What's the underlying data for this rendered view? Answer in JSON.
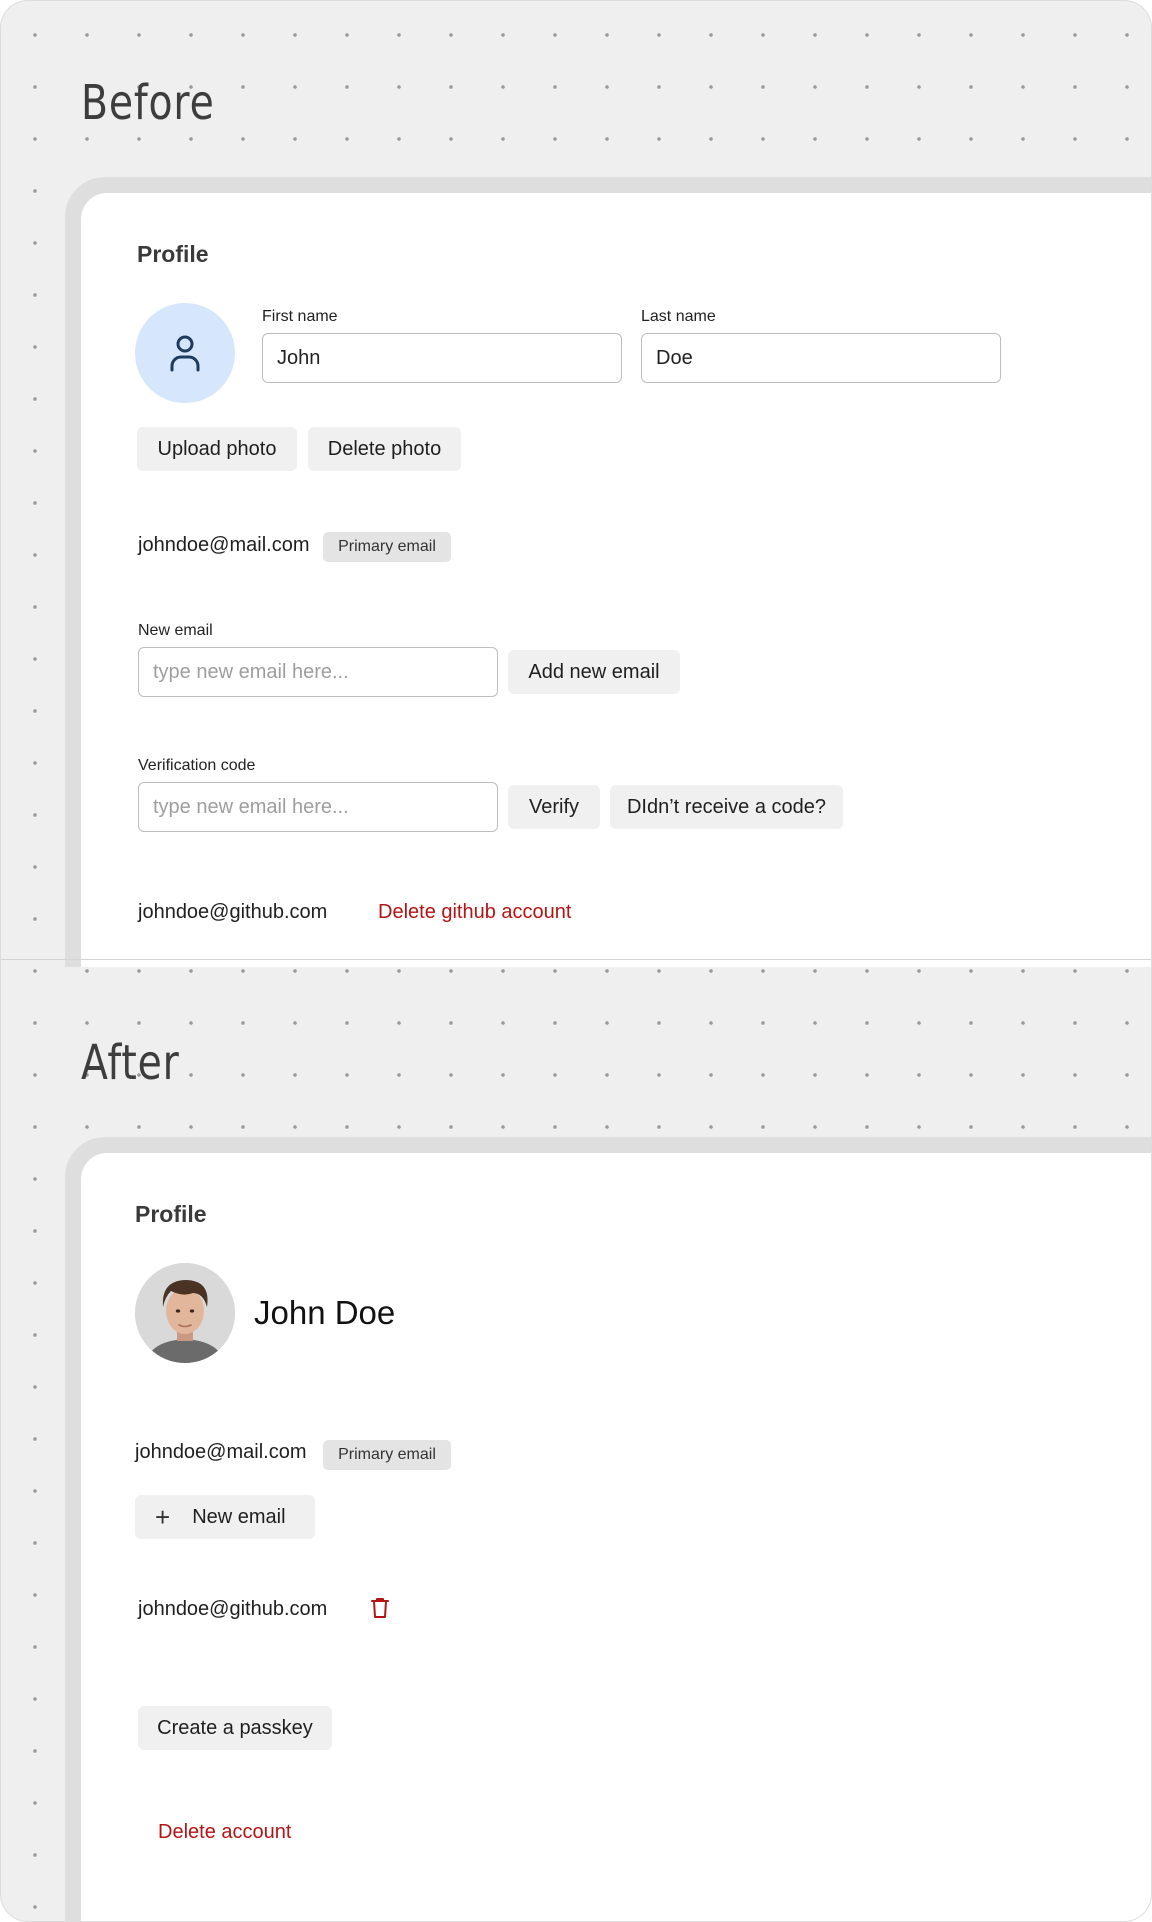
{
  "before": {
    "section_label": "Before",
    "profile_title": "Profile",
    "avatar_icon": "user-icon",
    "first_name": {
      "label": "First name",
      "value": "John"
    },
    "last_name": {
      "label": "Last name",
      "value": "Doe"
    },
    "upload_photo": "Upload photo",
    "delete_photo": "Delete photo",
    "primary_email": "johndoe@mail.com",
    "primary_badge": "Primary email",
    "new_email": {
      "label": "New email",
      "placeholder": "type new email here...",
      "button": "Add new email"
    },
    "verification": {
      "label": "Verification code",
      "placeholder": "type new email here...",
      "verify": "Verify",
      "resend": "DIdn’t receive a code?"
    },
    "github_email": "johndoe@github.com",
    "delete_github": "Delete github account"
  },
  "after": {
    "section_label": "After",
    "profile_title": "Profile",
    "display_name": "John Doe",
    "primary_email": "johndoe@mail.com",
    "primary_badge": "Primary email",
    "new_email_button": "New email",
    "github_email": "johndoe@github.com",
    "delete_icon": "trash-icon",
    "create_passkey": "Create a passkey",
    "delete_account": "Delete account"
  },
  "colors": {
    "accent_blue": "#1e3a5f",
    "avatar_bg": "#d6e6fc",
    "danger": "#b31414",
    "button_bg": "#f0f0f0",
    "canvas_bg": "#efefef"
  }
}
